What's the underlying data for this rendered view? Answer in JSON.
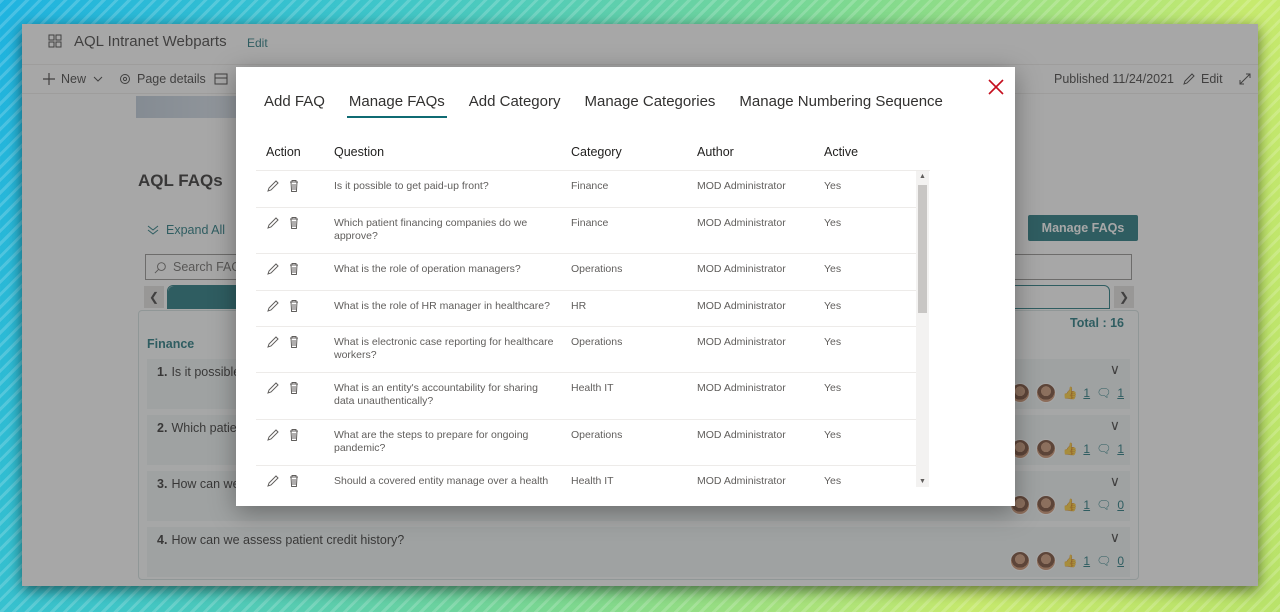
{
  "site": {
    "title": "AQL Intranet Webparts",
    "edit": "Edit"
  },
  "cmdbar": {
    "new": "New",
    "page_details": "Page details",
    "published": "Published 11/24/2021",
    "edit": "Edit"
  },
  "page": {
    "faq_title": "AQL FAQs",
    "expand_all": "Expand All",
    "manage_faqs_button": "Manage FAQs",
    "search_placeholder": "Search FAQ",
    "total": "Total : 16",
    "category": "Finance",
    "items": [
      {
        "num": "1.",
        "question": "Is it possible",
        "likes": "1",
        "comments": "1"
      },
      {
        "num": "2.",
        "question": "Which patie",
        "likes": "1",
        "comments": "1"
      },
      {
        "num": "3.",
        "question": "How can we",
        "likes": "1",
        "comments": "0"
      },
      {
        "num": "4.",
        "question": "How can we assess patient credit history?",
        "likes": "1",
        "comments": "0"
      }
    ]
  },
  "modal": {
    "tabs": [
      "Add FAQ",
      "Manage FAQs",
      "Add Category",
      "Manage Categories",
      "Manage Numbering Sequence"
    ],
    "active_tab": "Manage FAQs",
    "columns": {
      "action": "Action",
      "question": "Question",
      "category": "Category",
      "author": "Author",
      "active": "Active"
    },
    "rows": [
      {
        "question": "Is it possible to get paid-up front?",
        "category": "Finance",
        "author": "MOD Administrator",
        "active": "Yes"
      },
      {
        "question": "Which patient financing companies do we approve?",
        "category": "Finance",
        "author": "MOD Administrator",
        "active": "Yes"
      },
      {
        "question": "What is the role of operation managers?",
        "category": "Operations",
        "author": "MOD Administrator",
        "active": "Yes"
      },
      {
        "question": "What is the role of HR manager in healthcare?",
        "category": "HR",
        "author": "MOD Administrator",
        "active": "Yes"
      },
      {
        "question": "What is electronic case reporting for healthcare workers?",
        "category": "Operations",
        "author": "MOD Administrator",
        "active": "Yes"
      },
      {
        "question": "What is an entity's accountability for sharing data unauthentically?",
        "category": "Health IT",
        "author": "MOD Administrator",
        "active": "Yes"
      },
      {
        "question": "What are the steps to prepare for ongoing pandemic?",
        "category": "Operations",
        "author": "MOD Administrator",
        "active": "Yes"
      },
      {
        "question": "Should a covered entity manage over a health",
        "category": "Health IT",
        "author": "MOD Administrator",
        "active": "Yes"
      }
    ]
  },
  "colors": {
    "accent": "#0f6b73",
    "close": "#c50f1f"
  }
}
